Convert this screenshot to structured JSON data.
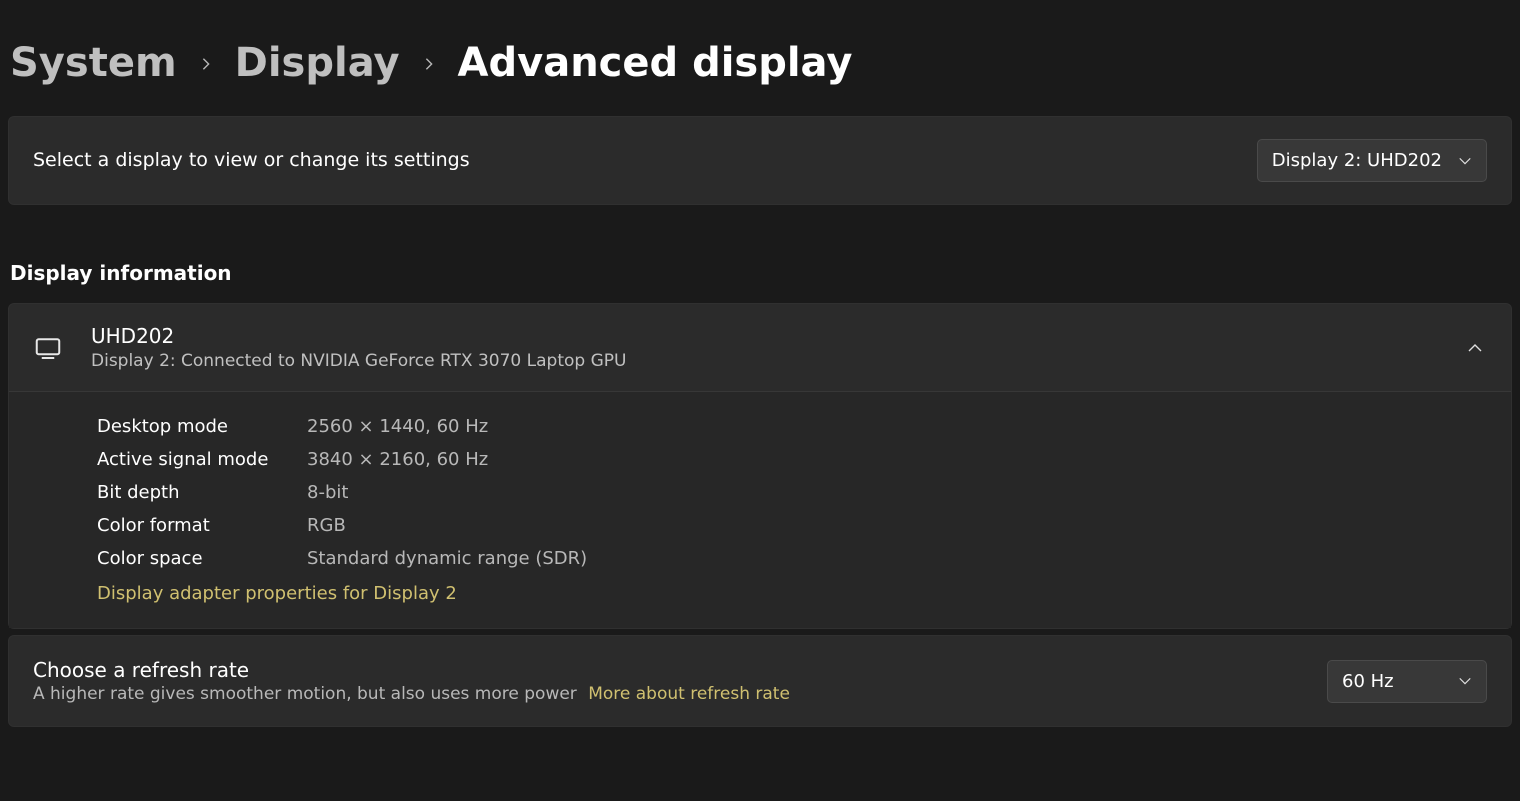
{
  "breadcrumb": {
    "system": "System",
    "display": "Display",
    "current": "Advanced display"
  },
  "select_display": {
    "label": "Select a display to view or change its settings",
    "value": "Display 2: UHD202"
  },
  "section_heading": "Display information",
  "display_info": {
    "name": "UHD202",
    "subtitle": "Display 2: Connected to NVIDIA GeForce RTX 3070 Laptop GPU",
    "rows": [
      {
        "label": "Desktop mode",
        "value": "2560 × 1440, 60 Hz"
      },
      {
        "label": "Active signal mode",
        "value": "3840 × 2160, 60 Hz"
      },
      {
        "label": "Bit depth",
        "value": "8-bit"
      },
      {
        "label": "Color format",
        "value": "RGB"
      },
      {
        "label": "Color space",
        "value": "Standard dynamic range (SDR)"
      }
    ],
    "adapter_link": "Display adapter properties for Display 2"
  },
  "refresh_rate": {
    "title": "Choose a refresh rate",
    "subtitle": "A higher rate gives smoother motion, but also uses more power",
    "link": "More about refresh rate",
    "value": "60 Hz"
  }
}
